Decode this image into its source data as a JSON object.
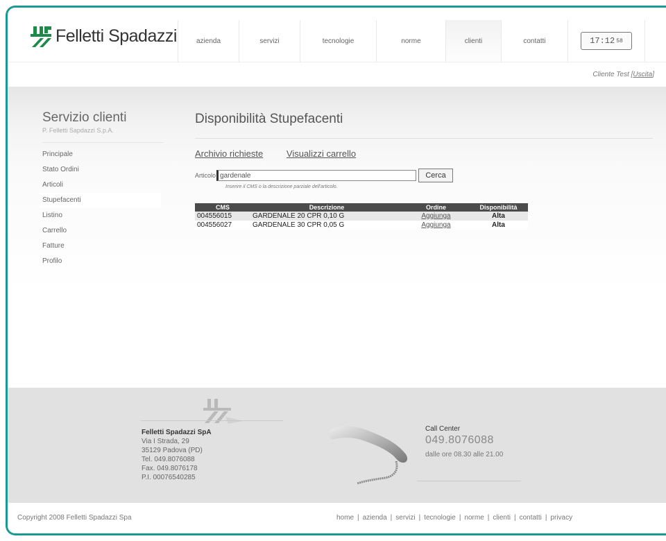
{
  "brand": {
    "name": "Felletti Spadazzi"
  },
  "nav": {
    "items": [
      {
        "label": "azienda",
        "width": 88
      },
      {
        "label": "servizi",
        "width": 88
      },
      {
        "label": "tecnologie",
        "width": 110
      },
      {
        "label": "norme",
        "width": 100
      },
      {
        "label": "clienti",
        "width": 80,
        "active": true
      },
      {
        "label": "contatti",
        "width": 96
      }
    ],
    "clock": {
      "time": "17:12",
      "seconds": "58"
    }
  },
  "user": {
    "name": "Cliente Test",
    "logout_label": "Uscita"
  },
  "sidebar": {
    "title": "Servizio clienti",
    "subtitle": "P. Felletti Sapdazzi S.p.A.",
    "items": [
      {
        "label": "Principale"
      },
      {
        "label": "Stato Ordini"
      },
      {
        "label": "Articoli"
      },
      {
        "label": "Stupefacenti",
        "active": true
      },
      {
        "label": "Listino"
      },
      {
        "label": "Carrello"
      },
      {
        "label": "Fatture"
      },
      {
        "label": "Profilo"
      }
    ]
  },
  "main": {
    "title": "Disponibilità Stupefacenti",
    "links": {
      "archive": "Archivio richieste",
      "cart": "Visualizzi carrello"
    },
    "search": {
      "label": "Articolo",
      "value": "gardenale",
      "button": "Cerca",
      "hint": "Inserire il CMS o la descrizione parziale dell'articolo."
    },
    "table": {
      "headers": {
        "cms": "CMS",
        "desc": "Descrizione",
        "order": "Ordine",
        "avail": "Disponibilità"
      },
      "rows": [
        {
          "cms": "004556015",
          "desc": "GARDENALE 20 CPR 0,10 G",
          "order": "Aggiunga",
          "avail": "Alta"
        },
        {
          "cms": "004556027",
          "desc": "GARDENALE 30 CPR 0,05 G",
          "order": "Aggiunga",
          "avail": "Alta"
        }
      ]
    }
  },
  "footer": {
    "company": {
      "name": "Felletti Spadazzi SpA",
      "address1": "Via I Strada, 29",
      "address2": "35129 Padova (PD)",
      "tel": "Tel. 049.8076088",
      "fax": "Fax. 049.8076178",
      "vat": "P.I. 00076540285"
    },
    "callcenter": {
      "title": "Call Center",
      "number": "049.8076088",
      "hours": "dalle ore 08.30 alle 21.00"
    },
    "copyright": "Copyright 2008 Felletti Spadazzi Spa",
    "links": [
      "home",
      "azienda",
      "servizi",
      "tecnologie",
      "norme",
      "clienti",
      "contatti",
      "privacy"
    ]
  },
  "colors": {
    "frame": "#1a9a8e",
    "logo_green": "#1d8a4a",
    "table_header": "#4b4b4b"
  }
}
